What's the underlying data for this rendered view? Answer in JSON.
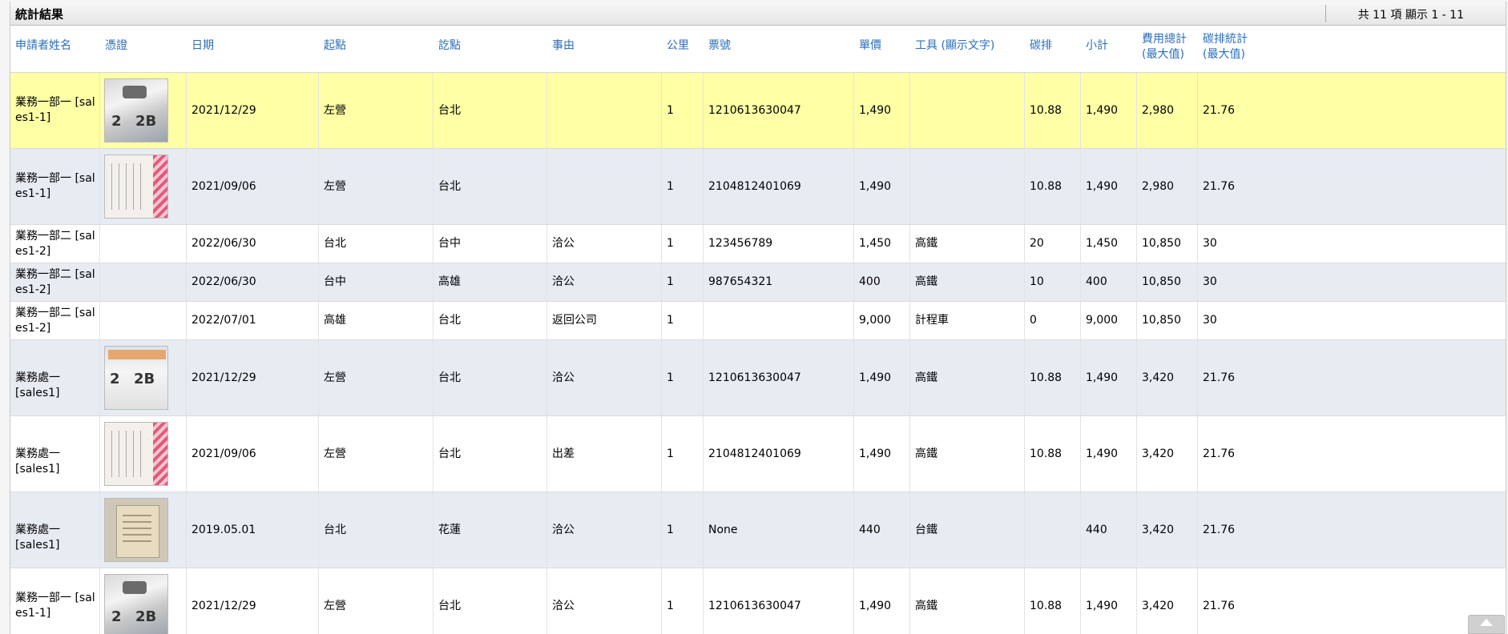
{
  "panel": {
    "title": "統計結果",
    "count_text": "共 11 項 顯示 1 - 11"
  },
  "columns": [
    {
      "key": "name",
      "label": "申請者姓名"
    },
    {
      "key": "voucher",
      "label": "憑證"
    },
    {
      "key": "date",
      "label": "日期"
    },
    {
      "key": "from",
      "label": "起點"
    },
    {
      "key": "to",
      "label": "訖點"
    },
    {
      "key": "reason",
      "label": "事由"
    },
    {
      "key": "km",
      "label": "公里"
    },
    {
      "key": "ticket",
      "label": "票號"
    },
    {
      "key": "price",
      "label": "單價"
    },
    {
      "key": "tool",
      "label": "工具 (顯示文字)"
    },
    {
      "key": "carbon",
      "label": "碳排"
    },
    {
      "key": "subtotal",
      "label": "小計"
    },
    {
      "key": "cost_total",
      "label": "費用總計(最大值)"
    },
    {
      "key": "carbon_total",
      "label": "碳排統計(最大值)"
    }
  ],
  "rows": [
    {
      "name": "業務一部一 [sales1-1]",
      "voucher": "ticket-photo-a",
      "date": "2021/12/29",
      "from": "左營",
      "to": "台北",
      "reason": "",
      "km": "1",
      "ticket": "1210613630047",
      "price": "1,490",
      "tool": "",
      "carbon": "10.88",
      "subtotal": "1,490",
      "cost_total": "2,980",
      "carbon_total": "21.76"
    },
    {
      "name": "業務一部一 [sales1-1]",
      "voucher": "ticket-photo-b",
      "date": "2021/09/06",
      "from": "左營",
      "to": "台北",
      "reason": "",
      "km": "1",
      "ticket": "2104812401069",
      "price": "1,490",
      "tool": "",
      "carbon": "10.88",
      "subtotal": "1,490",
      "cost_total": "2,980",
      "carbon_total": "21.76"
    },
    {
      "name": "業務一部二 [sales1-2]",
      "voucher": "",
      "date": "2022/06/30",
      "from": "台北",
      "to": "台中",
      "reason": "洽公",
      "km": "1",
      "ticket": "123456789",
      "price": "1,450",
      "tool": "高鐵",
      "carbon": "20",
      "subtotal": "1,450",
      "cost_total": "10,850",
      "carbon_total": "30"
    },
    {
      "name": "業務一部二 [sales1-2]",
      "voucher": "",
      "date": "2022/06/30",
      "from": "台中",
      "to": "高雄",
      "reason": "洽公",
      "km": "1",
      "ticket": "987654321",
      "price": "400",
      "tool": "高鐵",
      "carbon": "10",
      "subtotal": "400",
      "cost_total": "10,850",
      "carbon_total": "30"
    },
    {
      "name": "業務一部二 [sales1-2]",
      "voucher": "",
      "date": "2022/07/01",
      "from": "高雄",
      "to": "台北",
      "reason": "返回公司",
      "km": "1",
      "ticket": "",
      "price": "9,000",
      "tool": "計程車",
      "carbon": "0",
      "subtotal": "9,000",
      "cost_total": "10,850",
      "carbon_total": "30"
    },
    {
      "name": "業務處一 [sales1]",
      "voucher": "ticket-photo-c",
      "date": "2021/12/29",
      "from": "左營",
      "to": "台北",
      "reason": "洽公",
      "km": "1",
      "ticket": "1210613630047",
      "price": "1,490",
      "tool": "高鐵",
      "carbon": "10.88",
      "subtotal": "1,490",
      "cost_total": "3,420",
      "carbon_total": "21.76"
    },
    {
      "name": "業務處一 [sales1]",
      "voucher": "ticket-photo-b",
      "date": "2021/09/06",
      "from": "左營",
      "to": "台北",
      "reason": "出差",
      "km": "1",
      "ticket": "2104812401069",
      "price": "1,490",
      "tool": "高鐵",
      "carbon": "10.88",
      "subtotal": "1,490",
      "cost_total": "3,420",
      "carbon_total": "21.76"
    },
    {
      "name": "業務處一 [sales1]",
      "voucher": "ticket-photo-d",
      "date": "2019.05.01",
      "from": "台北",
      "to": "花蓮",
      "reason": "洽公",
      "km": "1",
      "ticket": "None",
      "price": "440",
      "tool": "台鐵",
      "carbon": "",
      "subtotal": "440",
      "cost_total": "3,420",
      "carbon_total": "21.76"
    },
    {
      "name": "業務一部一 [sales1-1]",
      "voucher": "ticket-photo-a",
      "date": "2021/12/29",
      "from": "左營",
      "to": "台北",
      "reason": "洽公",
      "km": "1",
      "ticket": "1210613630047",
      "price": "1,490",
      "tool": "高鐵",
      "carbon": "10.88",
      "subtotal": "1,490",
      "cost_total": "3,420",
      "carbon_total": "21.76"
    }
  ],
  "colors": {
    "header_text": "#2a6ebb",
    "highlight_row": "#ffffa6",
    "alt_row": "#e7ebf2",
    "plain_row": "#ffffff"
  },
  "icons": {
    "scroll_top": "chevron-up-icon"
  }
}
